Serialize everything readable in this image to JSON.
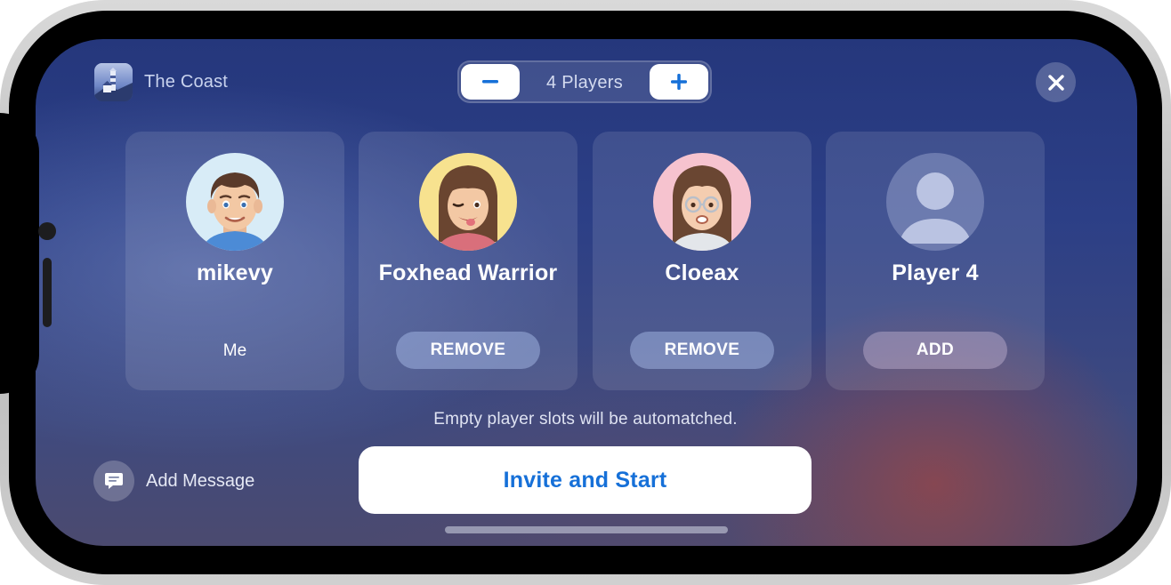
{
  "header": {
    "game_title": "The Coast",
    "game_thumb_icon": "lighthouse-app-icon",
    "player_count_label": "4 Players",
    "decrement_icon": "minus-icon",
    "increment_icon": "plus-icon",
    "close_icon": "close-icon"
  },
  "players": [
    {
      "name": "mikevy",
      "role": "Me",
      "avatar_icon": "memoji-boy-avatar",
      "avatar_bg": "#d8ecf7"
    },
    {
      "name": "Foxhead Warrior",
      "action": "REMOVE",
      "avatar_icon": "memoji-girl-wink-avatar",
      "avatar_bg": "#f7e28f"
    },
    {
      "name": "Cloeax",
      "action": "REMOVE",
      "avatar_icon": "memoji-girl-glasses-avatar",
      "avatar_bg": "#f6c3cf"
    },
    {
      "name": "Player 4",
      "action": "ADD",
      "avatar_icon": "placeholder-person-avatar",
      "avatar_bg": "#8892b8"
    }
  ],
  "footer": {
    "automatch_note": "Empty player slots will be automatched.",
    "add_message_label": "Add Message",
    "message_icon": "message-bubble-icon",
    "invite_label": "Invite and Start"
  },
  "colors": {
    "accent": "#1670d8",
    "background_top": "#25377c",
    "background_glow": "#9b4646"
  }
}
